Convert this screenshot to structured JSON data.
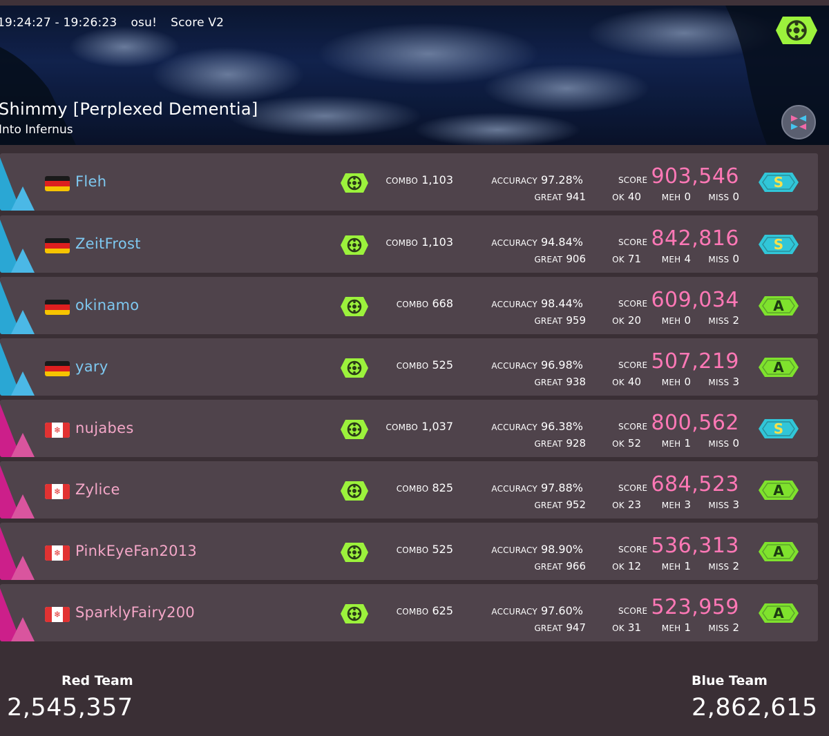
{
  "header": {
    "time_range": "19:24:27 - 19:26:23",
    "mode": "osu!",
    "scoring": "Score V2",
    "map_title": "Shimmy [Perplexed Dementia]",
    "map_artist": "Into Infernus"
  },
  "labels": {
    "combo": "COMBO",
    "accuracy": "ACCURACY",
    "score": "SCORE",
    "great": "GREAT",
    "ok": "OK",
    "meh": "MEH",
    "miss": "MISS"
  },
  "colors": {
    "blue_team": "#2aa7d4",
    "red_team": "#cc1f8a",
    "score_pink": "#ff78b6",
    "mode_green": "#9cf23c",
    "grade_s": "#31c6d8",
    "grade_a": "#7fe22d"
  },
  "players": [
    {
      "name": "Fleh",
      "team": "blue",
      "flag": "de",
      "combo": "1,103",
      "accuracy": "97.28%",
      "score": "903,546",
      "great": "941",
      "ok": "40",
      "meh": "0",
      "miss": "0",
      "grade": "S"
    },
    {
      "name": "ZeitFrost",
      "team": "blue",
      "flag": "de",
      "combo": "1,103",
      "accuracy": "94.84%",
      "score": "842,816",
      "great": "906",
      "ok": "71",
      "meh": "4",
      "miss": "0",
      "grade": "S"
    },
    {
      "name": "okinamo",
      "team": "blue",
      "flag": "de",
      "combo": "668",
      "accuracy": "98.44%",
      "score": "609,034",
      "great": "959",
      "ok": "20",
      "meh": "0",
      "miss": "2",
      "grade": "A"
    },
    {
      "name": "yary",
      "team": "blue",
      "flag": "de",
      "combo": "525",
      "accuracy": "96.98%",
      "score": "507,219",
      "great": "938",
      "ok": "40",
      "meh": "0",
      "miss": "3",
      "grade": "A"
    },
    {
      "name": "nujabes",
      "team": "red",
      "flag": "ca",
      "combo": "1,037",
      "accuracy": "96.38%",
      "score": "800,562",
      "great": "928",
      "ok": "52",
      "meh": "1",
      "miss": "0",
      "grade": "S"
    },
    {
      "name": "Zylice",
      "team": "red",
      "flag": "ca",
      "combo": "825",
      "accuracy": "97.88%",
      "score": "684,523",
      "great": "952",
      "ok": "23",
      "meh": "3",
      "miss": "3",
      "grade": "A"
    },
    {
      "name": "PinkEyeFan2013",
      "team": "red",
      "flag": "ca",
      "combo": "525",
      "accuracy": "98.90%",
      "score": "536,313",
      "great": "966",
      "ok": "12",
      "meh": "1",
      "miss": "2",
      "grade": "A"
    },
    {
      "name": "SparklyFairy200",
      "team": "red",
      "flag": "ca",
      "combo": "625",
      "accuracy": "97.60%",
      "score": "523,959",
      "great": "947",
      "ok": "31",
      "meh": "1",
      "miss": "2",
      "grade": "A"
    }
  ],
  "teams": {
    "red": {
      "name": "Red Team",
      "total": "2,545,357"
    },
    "blue": {
      "name": "Blue Team",
      "total": "2,862,615"
    }
  }
}
